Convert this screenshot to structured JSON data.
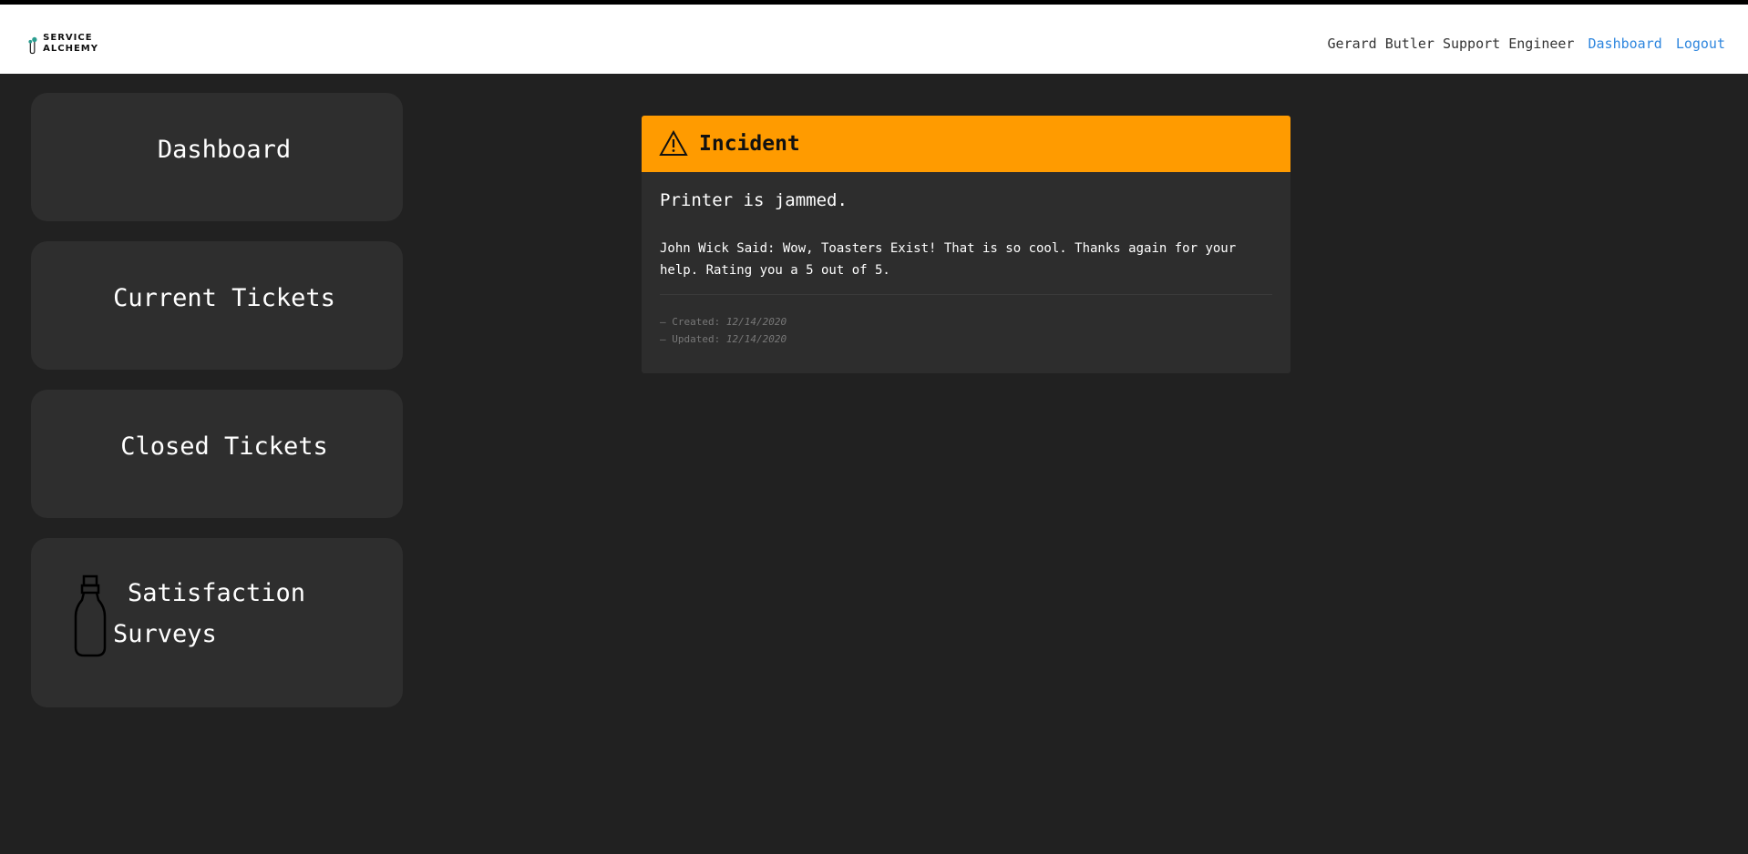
{
  "header": {
    "logo_line1": "SERVICE",
    "logo_line2": "ALCHEMY",
    "user": "Gerard Butler Support Engineer",
    "dashboard_link": "Dashboard",
    "logout_link": "Logout"
  },
  "sidebar": {
    "items": [
      {
        "label": "Dashboard"
      },
      {
        "label": "Current Tickets"
      },
      {
        "label": "Closed Tickets"
      },
      {
        "label": "Satisfaction Surveys",
        "icon": "bottle-icon"
      }
    ]
  },
  "ticket": {
    "type": "Incident",
    "icon": "warning-icon",
    "description": "Printer is jammed.",
    "comment": "John Wick Said: Wow, Toasters Exist! That is so cool. Thanks again for your help. Rating you a 5 out of 5.",
    "created_label": "— Created:",
    "created_date": "12/14/2020",
    "updated_label": "— Updated:",
    "updated_date": "12/14/2020"
  },
  "colors": {
    "background": "#212121",
    "card": "#2d2d2d",
    "sidebar_item": "#2e2e2e",
    "incident_header": "#ff9b00",
    "link": "#2e86de"
  }
}
